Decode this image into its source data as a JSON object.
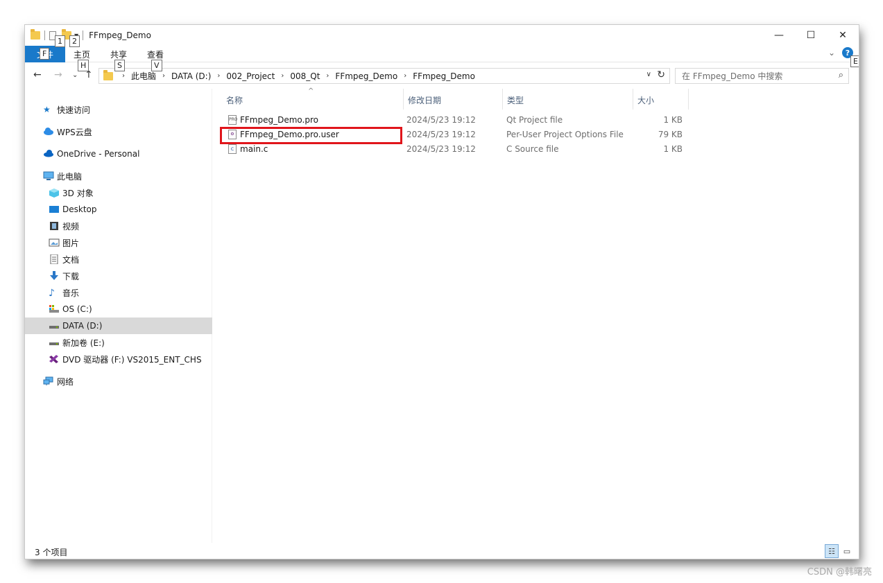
{
  "window": {
    "title": "FFmpeg_Demo"
  },
  "keytips": {
    "qat1": "1",
    "qat2": "2",
    "file": "F",
    "home": "H",
    "share": "S",
    "view": "V",
    "help": "E"
  },
  "ribbon": {
    "file_label": "文件",
    "tabs": [
      "主页",
      "共享",
      "查看"
    ]
  },
  "address": {
    "crumbs": [
      "此电脑",
      "DATA (D:)",
      "002_Project",
      "008_Qt",
      "FFmpeg_Demo",
      "FFmpeg_Demo"
    ]
  },
  "search": {
    "placeholder": "在 FFmpeg_Demo 中搜索"
  },
  "navpane": {
    "items": [
      {
        "label": "快速访问",
        "icon": "star-icon"
      },
      {
        "label": "WPS云盘",
        "icon": "cloud-icon"
      },
      {
        "label": "OneDrive - Personal",
        "icon": "onedrive-icon"
      },
      {
        "label": "此电脑",
        "icon": "computer-icon"
      },
      {
        "label": "3D 对象",
        "icon": "cube-icon"
      },
      {
        "label": "Desktop",
        "icon": "desktop-icon"
      },
      {
        "label": "视频",
        "icon": "video-icon"
      },
      {
        "label": "图片",
        "icon": "pictures-icon"
      },
      {
        "label": "文档",
        "icon": "documents-icon"
      },
      {
        "label": "下载",
        "icon": "download-icon"
      },
      {
        "label": "音乐",
        "icon": "music-icon"
      },
      {
        "label": "OS (C:)",
        "icon": "drive-c-icon"
      },
      {
        "label": "DATA (D:)",
        "icon": "drive-d-icon",
        "selected": true
      },
      {
        "label": "新加卷 (E:)",
        "icon": "drive-e-icon"
      },
      {
        "label": "DVD 驱动器 (F:) VS2015_ENT_CHS",
        "icon": "visual-studio-icon"
      },
      {
        "label": "网络",
        "icon": "network-icon"
      }
    ]
  },
  "filelist": {
    "columns": {
      "name": "名称",
      "date": "修改日期",
      "type": "类型",
      "size": "大小"
    },
    "rows": [
      {
        "name": "FFmpeg_Demo.pro",
        "date": "2024/5/23 19:12",
        "type": "Qt Project file",
        "size": "1 KB",
        "icon": "pro-file-icon"
      },
      {
        "name": "FFmpeg_Demo.pro.user",
        "date": "2024/5/23 19:12",
        "type": "Per-User Project Options File",
        "size": "79 KB",
        "icon": "user-file-icon",
        "highlighted": true
      },
      {
        "name": "main.c",
        "date": "2024/5/23 19:12",
        "type": "C Source file",
        "size": "1 KB",
        "icon": "c-file-icon"
      }
    ]
  },
  "status": {
    "count": "3 个项目"
  },
  "watermark": "CSDN @韩曙亮",
  "colors": {
    "accent": "#1979ca",
    "highlight_box": "#e0151b",
    "selected_bg": "#d9d9d9"
  }
}
